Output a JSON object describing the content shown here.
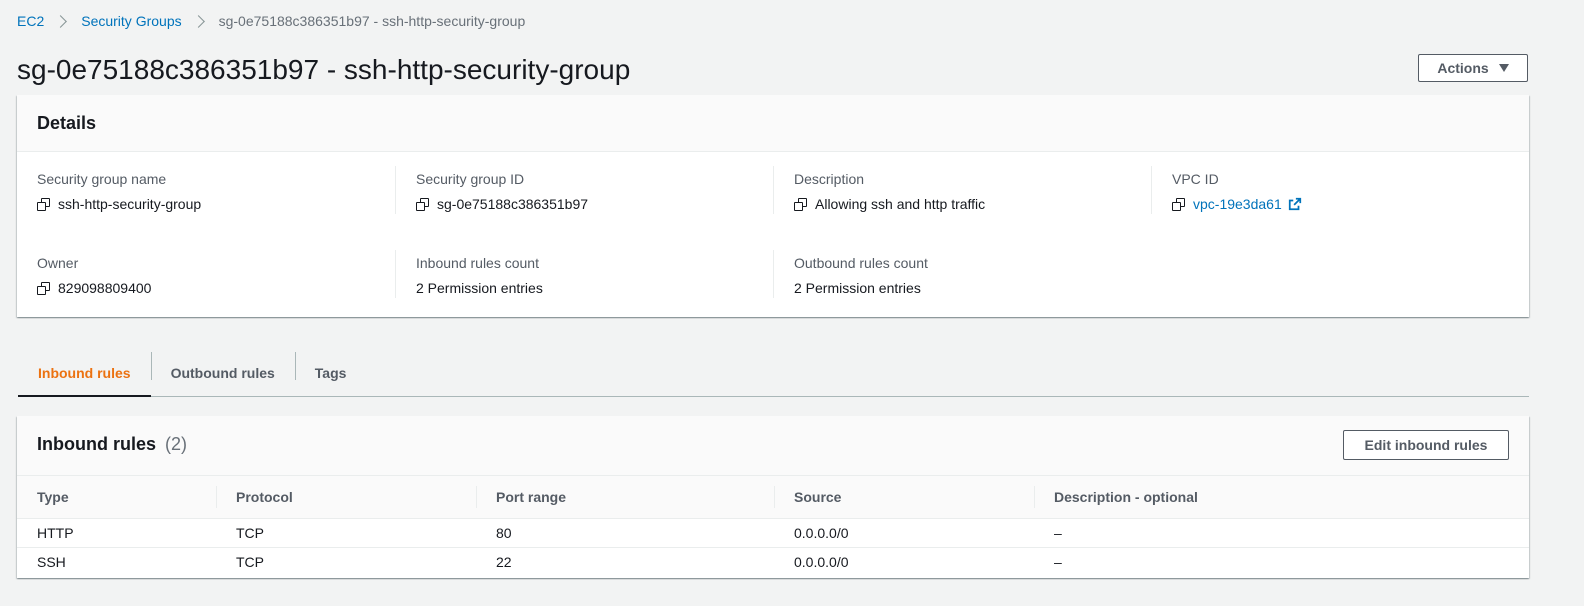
{
  "breadcrumb": {
    "items": [
      "EC2",
      "Security Groups"
    ],
    "current": "sg-0e75188c386351b97 - ssh-http-security-group"
  },
  "page": {
    "title": "sg-0e75188c386351b97 - ssh-http-security-group",
    "actions_label": "Actions"
  },
  "details": {
    "title": "Details",
    "fields": [
      {
        "label": "Security group name",
        "value": "ssh-http-security-group"
      },
      {
        "label": "Security group ID",
        "value": "sg-0e75188c386351b97"
      },
      {
        "label": "Description",
        "value": "Allowing ssh and http traffic"
      },
      {
        "label": "VPC ID",
        "value": "vpc-19e3da61"
      },
      {
        "label": "Owner",
        "value": "829098809400"
      },
      {
        "label": "Inbound rules count",
        "value": "2 Permission entries"
      },
      {
        "label": "Outbound rules count",
        "value": "2 Permission entries"
      }
    ]
  },
  "tabs": [
    "Inbound rules",
    "Outbound rules",
    "Tags"
  ],
  "inbound": {
    "title": "Inbound rules",
    "count": "(2)",
    "edit_label": "Edit inbound rules",
    "columns": [
      "Type",
      "Protocol",
      "Port range",
      "Source",
      "Description - optional"
    ],
    "rows": [
      [
        "HTTP",
        "TCP",
        "80",
        "0.0.0.0/0",
        "–"
      ],
      [
        "SSH",
        "TCP",
        "22",
        "0.0.0.0/0",
        "–"
      ]
    ]
  },
  "colors": {
    "link": "#0073bb",
    "active_tab": "#ec7211",
    "text": "#16191f"
  }
}
